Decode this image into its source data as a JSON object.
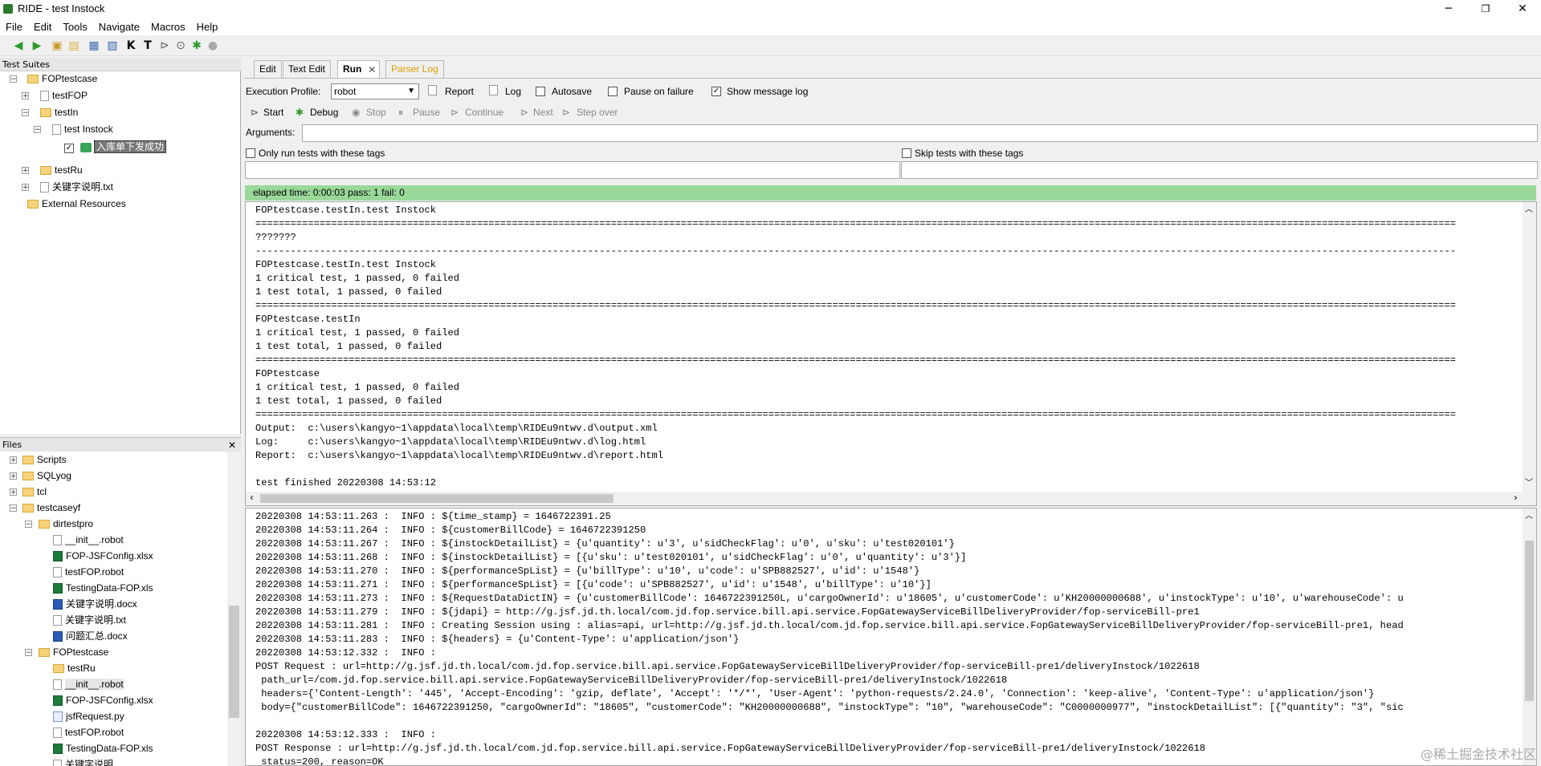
{
  "window": {
    "title": "RIDE - test Instock",
    "minimize": "─",
    "maximize": "❐",
    "close": "✕"
  },
  "menu": [
    "File",
    "Edit",
    "Tools",
    "Navigate",
    "Macros",
    "Help"
  ],
  "test_suites": {
    "header": "Test Suites",
    "nodes": {
      "root": "FOPtestcase",
      "testFOP": "testFOP",
      "testIn": "testIn",
      "test_instock": "test Instock",
      "keyword": "入库单下发成功",
      "testRu": "testRu",
      "keywords_txt": "关键字说明.txt",
      "external": "External Resources"
    }
  },
  "files": {
    "header": "Files",
    "close": "✕",
    "items": [
      "Scripts",
      "SQLyog",
      "tcl",
      "testcaseyf",
      "dirtestpro",
      "__init__.robot",
      "FOP-JSFConfig.xlsx",
      "testFOP.robot",
      "TestingData-FOP.xls",
      "关键字说明.docx",
      "关键字说明.txt",
      "问题汇总.docx",
      "FOPtestcase",
      "testRu",
      "__init__.robot",
      "FOP-JSFConfig.xlsx",
      "jsfRequest.py",
      "testFOP.robot",
      "TestingData-FOP.xls",
      "关键字说明..."
    ]
  },
  "tabs": [
    "Edit",
    "Text Edit",
    "Run",
    "Parser Log"
  ],
  "run": {
    "execution_profile_label": "Execution Profile:",
    "execution_profile_value": "robot",
    "report": "Report",
    "log": "Log",
    "autosave": "Autosave",
    "pause_on_failure": "Pause on failure",
    "show_message_log": "Show message log",
    "start": "Start",
    "debug": "Debug",
    "stop": "Stop",
    "pause": "Pause",
    "continue": "Continue",
    "next": "Next",
    "step_over": "Step over",
    "arguments_label": "Arguments:",
    "only_run_tags": "Only run tests with these tags",
    "skip_tags": "Skip tests with these tags",
    "status": "elapsed time: 0:00:03     pass: 1      fail: 0"
  },
  "output_lines": [
    "FOPtestcase.testIn.test Instock",
    "==============================================================================================================================================================================================================",
    "???????",
    "--------------------------------------------------------------------------------------------------------------------------------------------------------------------------------------------------------------",
    "FOPtestcase.testIn.test Instock",
    "1 critical test, 1 passed, 0 failed",
    "1 test total, 1 passed, 0 failed",
    "==============================================================================================================================================================================================================",
    "FOPtestcase.testIn",
    "1 critical test, 1 passed, 0 failed",
    "1 test total, 1 passed, 0 failed",
    "==============================================================================================================================================================================================================",
    "FOPtestcase",
    "1 critical test, 1 passed, 0 failed",
    "1 test total, 1 passed, 0 failed",
    "==============================================================================================================================================================================================================",
    "Output:  c:\\users\\kangyo~1\\appdata\\local\\temp\\RIDEu9ntwv.d\\output.xml",
    "Log:     c:\\users\\kangyo~1\\appdata\\local\\temp\\RIDEu9ntwv.d\\log.html",
    "Report:  c:\\users\\kangyo~1\\appdata\\local\\temp\\RIDEu9ntwv.d\\report.html",
    "",
    "test finished 20220308 14:53:12"
  ],
  "message_lines": [
    "20220308 14:53:11.263 :  INFO : ${time_stamp} = 1646722391.25",
    "20220308 14:53:11.264 :  INFO : ${customerBillCode} = 1646722391250",
    "20220308 14:53:11.267 :  INFO : ${instockDetailList} = {u'quantity': u'3', u'sidCheckFlag': u'0', u'sku': u'test020101'}",
    "20220308 14:53:11.268 :  INFO : ${instockDetailList} = [{u'sku': u'test020101', u'sidCheckFlag': u'0', u'quantity': u'3'}]",
    "20220308 14:53:11.270 :  INFO : ${performanceSpList} = {u'billType': u'10', u'code': u'SPB882527', u'id': u'1548'}",
    "20220308 14:53:11.271 :  INFO : ${performanceSpList} = [{u'code': u'SPB882527', u'id': u'1548', u'billType': u'10'}]",
    "20220308 14:53:11.273 :  INFO : ${RequestDataDictIN} = {u'customerBillCode': 1646722391250L, u'cargoOwnerId': u'18605', u'customerCode': u'KH20000000688', u'instockType': u'10', u'warehouseCode': u",
    "20220308 14:53:11.279 :  INFO : ${jdapi} = http://g.jsf.jd.th.local/com.jd.fop.service.bill.api.service.FopGatewayServiceBillDeliveryProvider/fop-serviceBill-pre1",
    "20220308 14:53:11.281 :  INFO : Creating Session using : alias=api, url=http://g.jsf.jd.th.local/com.jd.fop.service.bill.api.service.FopGatewayServiceBillDeliveryProvider/fop-serviceBill-pre1, head",
    "20220308 14:53:11.283 :  INFO : ${headers} = {u'Content-Type': u'application/json'}",
    "20220308 14:53:12.332 :  INFO :",
    "POST Request : url=http://g.jsf.jd.th.local/com.jd.fop.service.bill.api.service.FopGatewayServiceBillDeliveryProvider/fop-serviceBill-pre1/deliveryInstock/1022618",
    " path_url=/com.jd.fop.service.bill.api.service.FopGatewayServiceBillDeliveryProvider/fop-serviceBill-pre1/deliveryInstock/1022618",
    " headers={'Content-Length': '445', 'Accept-Encoding': 'gzip, deflate', 'Accept': '*/*', 'User-Agent': 'python-requests/2.24.0', 'Connection': 'keep-alive', 'Content-Type': u'application/json'}",
    " body={\"customerBillCode\": 1646722391250, \"cargoOwnerId\": \"18605\", \"customerCode\": \"KH20000000688\", \"instockType\": \"10\", \"warehouseCode\": \"C0000000977\", \"instockDetailList\": [{\"quantity\": \"3\", \"sic",
    "",
    "20220308 14:53:12.333 :  INFO :",
    "POST Response : url=http://g.jsf.jd.th.local/com.jd.fop.service.bill.api.service.FopGatewayServiceBillDeliveryProvider/fop-serviceBill-pre1/deliveryInstock/1022618",
    " status=200, reason=OK"
  ],
  "watermark": "@稀土掘金技术社区"
}
